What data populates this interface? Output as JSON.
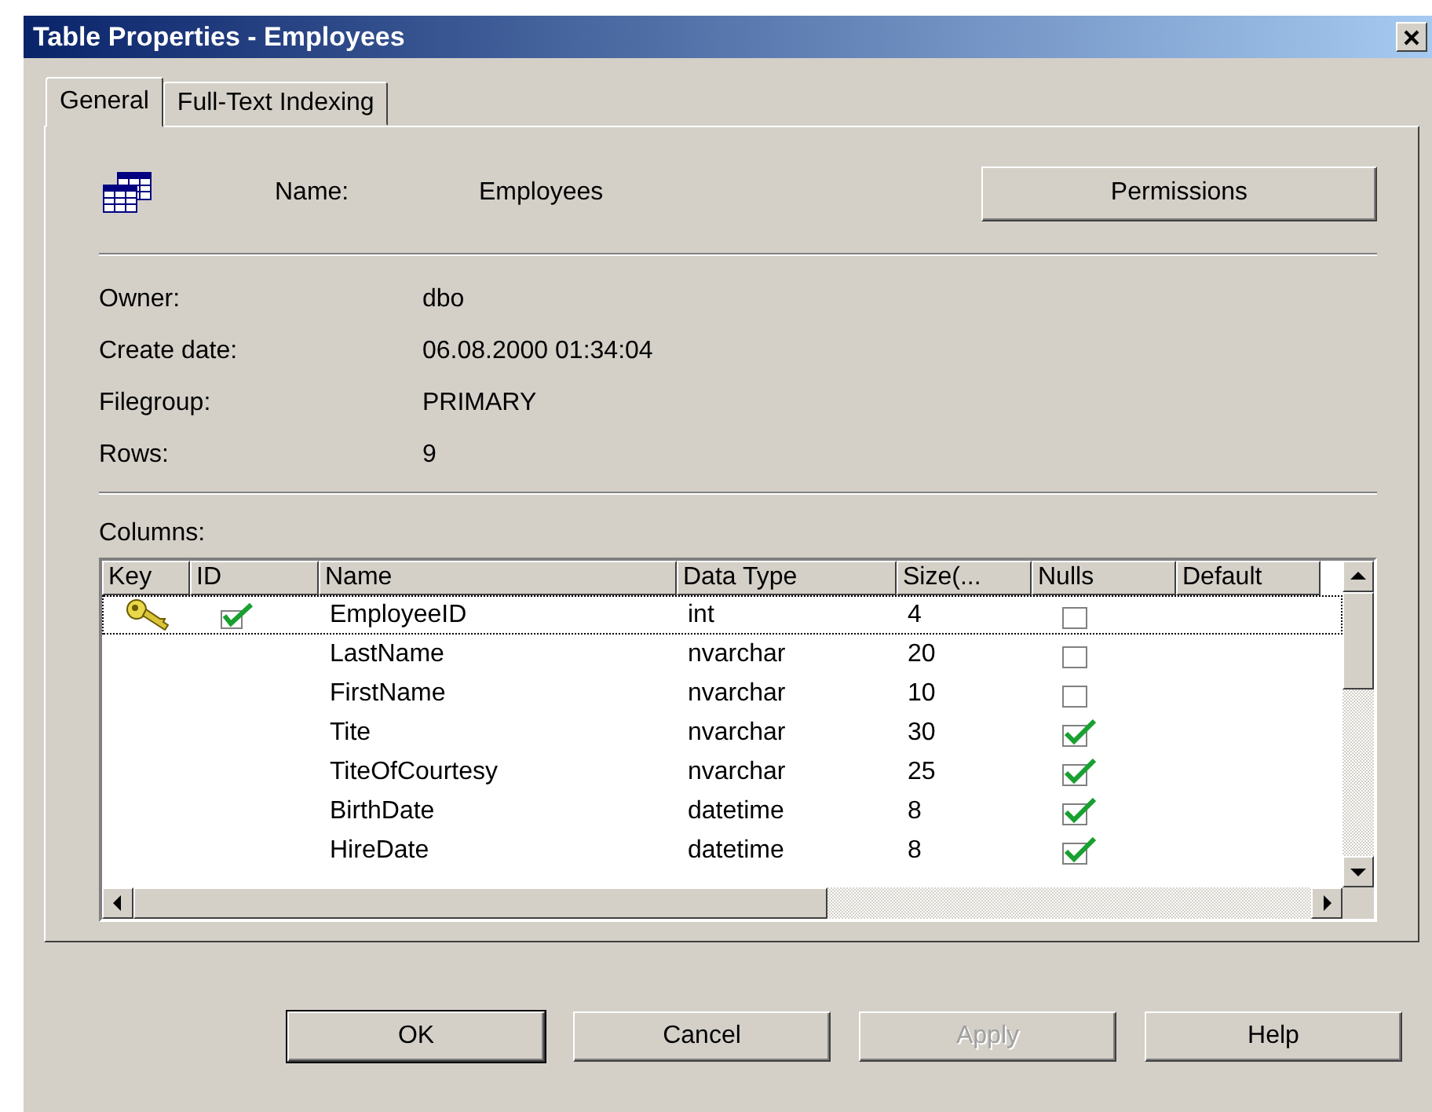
{
  "window": {
    "title": "Table Properties - Employees"
  },
  "tabs": [
    {
      "label": "General",
      "selected": true
    },
    {
      "label": "Full-Text Indexing",
      "selected": false
    }
  ],
  "name_label": "Name:",
  "name_value": "Employees",
  "permissions_button": "Permissions",
  "properties": [
    {
      "label": "Owner:",
      "value": "dbo"
    },
    {
      "label": "Create date:",
      "value": "06.08.2000 01:34:04"
    },
    {
      "label": "Filegroup:",
      "value": "PRIMARY"
    },
    {
      "label": "Rows:",
      "value": "9"
    }
  ],
  "columns_label": "Columns:",
  "table": {
    "columns": [
      "Key",
      "ID",
      "Name",
      "Data Type",
      "Size(...",
      "Nulls",
      "Default"
    ],
    "rows": [
      {
        "key": true,
        "identity": true,
        "name": "EmployeeID",
        "type": "int",
        "size": "4",
        "nulls": false,
        "selected": true
      },
      {
        "key": false,
        "identity": false,
        "name": "LastName",
        "type": "nvarchar",
        "size": "20",
        "nulls": false,
        "selected": false
      },
      {
        "key": false,
        "identity": false,
        "name": "FirstName",
        "type": "nvarchar",
        "size": "10",
        "nulls": false,
        "selected": false
      },
      {
        "key": false,
        "identity": false,
        "name": "Tite",
        "type": "nvarchar",
        "size": "30",
        "nulls": true,
        "selected": false
      },
      {
        "key": false,
        "identity": false,
        "name": "TiteOfCourtesy",
        "type": "nvarchar",
        "size": "25",
        "nulls": true,
        "selected": false
      },
      {
        "key": false,
        "identity": false,
        "name": "BirthDate",
        "type": "datetime",
        "size": "8",
        "nulls": true,
        "selected": false
      },
      {
        "key": false,
        "identity": false,
        "name": "HireDate",
        "type": "datetime",
        "size": "8",
        "nulls": true,
        "selected": false
      }
    ]
  },
  "buttons": [
    {
      "label": "OK",
      "default": true,
      "disabled": false
    },
    {
      "label": "Cancel",
      "default": false,
      "disabled": false
    },
    {
      "label": "Apply",
      "default": false,
      "disabled": true
    },
    {
      "label": "Help",
      "default": false,
      "disabled": false
    }
  ]
}
